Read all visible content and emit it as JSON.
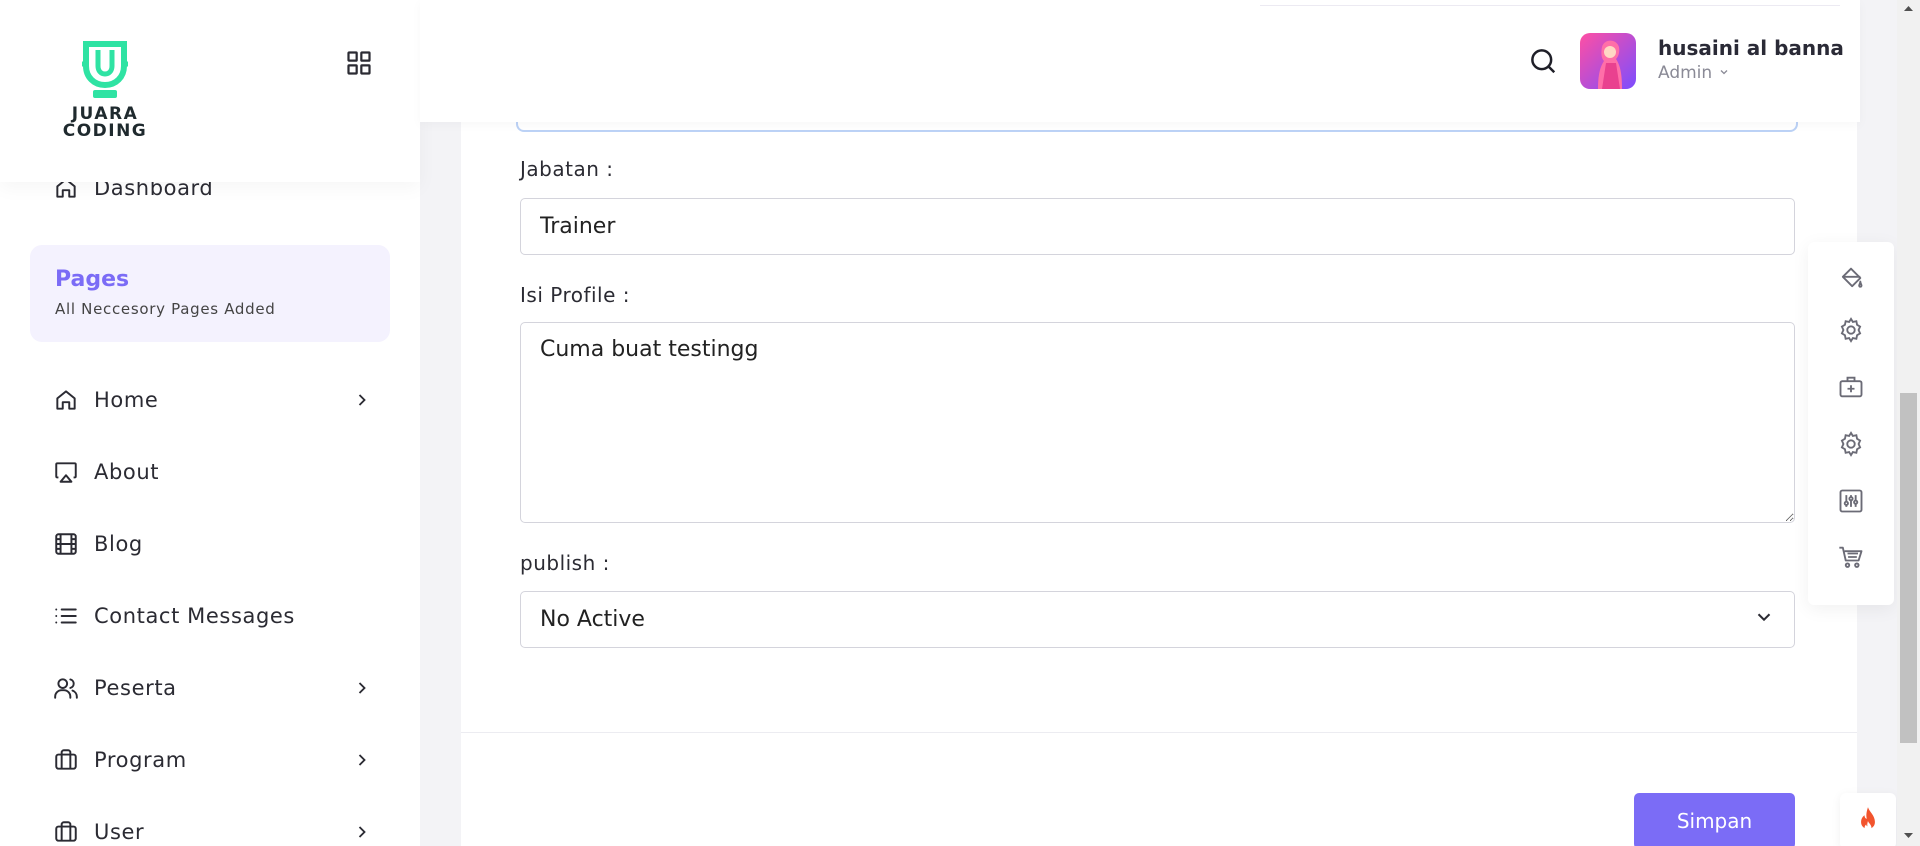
{
  "brand": {
    "logo_text_line1": "JUARA",
    "logo_text_line2": "CODING",
    "accent": "#7b6cf6",
    "logo_color": "#2fe3a3"
  },
  "sidebar": {
    "items": [
      {
        "label": "Dashboard",
        "icon": "home-icon"
      },
      {
        "label": "Home",
        "icon": "home-icon",
        "has_children": true
      },
      {
        "label": "About",
        "icon": "airplay-icon"
      },
      {
        "label": "Blog",
        "icon": "film-icon"
      },
      {
        "label": "Contact Messages",
        "icon": "list-icon"
      },
      {
        "label": "Peserta",
        "icon": "users-icon",
        "has_children": true
      },
      {
        "label": "Program",
        "icon": "briefcase-icon",
        "has_children": true
      },
      {
        "label": "User",
        "icon": "briefcase-icon",
        "has_children": true
      }
    ],
    "pages_box": {
      "title": "Pages",
      "subtitle": "All Neccesory Pages Added"
    }
  },
  "header": {
    "user_name": "husaini al banna",
    "user_role": "Admin"
  },
  "form": {
    "jabatan_label": "Jabatan :",
    "jabatan_value": "Trainer",
    "isi_profile_label": "Isi Profile :",
    "isi_profile_value": "Cuma buat testingg",
    "publish_label": "publish :",
    "publish_value": "No Active",
    "save_label": "Simpan"
  },
  "float_toolbar": {
    "icons": [
      "paint-bucket-icon",
      "gear-icon",
      "medical-case-icon",
      "gear-icon",
      "sliders-icon",
      "cart-icon"
    ]
  }
}
